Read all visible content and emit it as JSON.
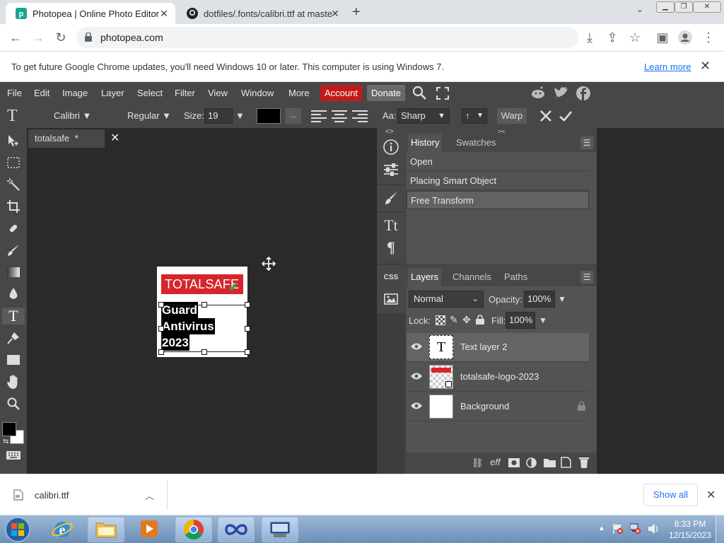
{
  "browser": {
    "tabs": [
      {
        "title": "Photopea | Online Photo Editor",
        "active": true
      },
      {
        "title": "dotfiles/.fonts/calibri.ttf at maste",
        "active": false
      }
    ],
    "new_tab": "+",
    "url": "photopea.com",
    "infobar": {
      "text": "To get future Google Chrome updates, you'll need Windows 10 or later. This computer is using Windows 7.",
      "link": "Learn more",
      "close": "✕"
    }
  },
  "menu": {
    "items": [
      "File",
      "Edit",
      "Image",
      "Layer",
      "Select",
      "Filter",
      "View",
      "Window",
      "More"
    ],
    "account": "Account",
    "donate": "Donate"
  },
  "options": {
    "font": "Calibri ▼",
    "style": "Regular ▼",
    "size_label": "Size:",
    "size_value": "19 px",
    "dots": "...",
    "aa_label": "Aa:",
    "aa_value": "Sharp",
    "orient": "↑",
    "warp": "Warp"
  },
  "document": {
    "tab_title": "totalsafe",
    "tab_modified": "*",
    "logo_text": "TOTALSAFE",
    "text_lines": [
      "Guard",
      "Antivirus",
      "2023"
    ]
  },
  "history": {
    "tabs": [
      "History",
      "Swatches"
    ],
    "items": [
      "Open",
      "Placing Smart Object",
      "Free Transform"
    ]
  },
  "layers": {
    "tabs": [
      "Layers",
      "Channels",
      "Paths"
    ],
    "blend_mode": "Normal",
    "opacity_label": "Opacity:",
    "opacity": "100%",
    "lock_label": "Lock:",
    "fill_label": "Fill:",
    "fill": "100%",
    "items": [
      {
        "name": "Text layer 2",
        "selected": true
      },
      {
        "name": "totalsafe-logo-2023",
        "selected": false
      },
      {
        "name": "Background",
        "selected": false,
        "locked": true
      }
    ]
  },
  "download": {
    "filename": "calibri.ttf",
    "show_all": "Show all"
  },
  "taskbar": {
    "time": "8:33 PM",
    "date": "12/15/2023"
  },
  "colors": {
    "accent_red": "#c01b1b",
    "logo_red": "#d7252b",
    "panel": "#474747",
    "canvas_bg": "#2a2a2a"
  }
}
